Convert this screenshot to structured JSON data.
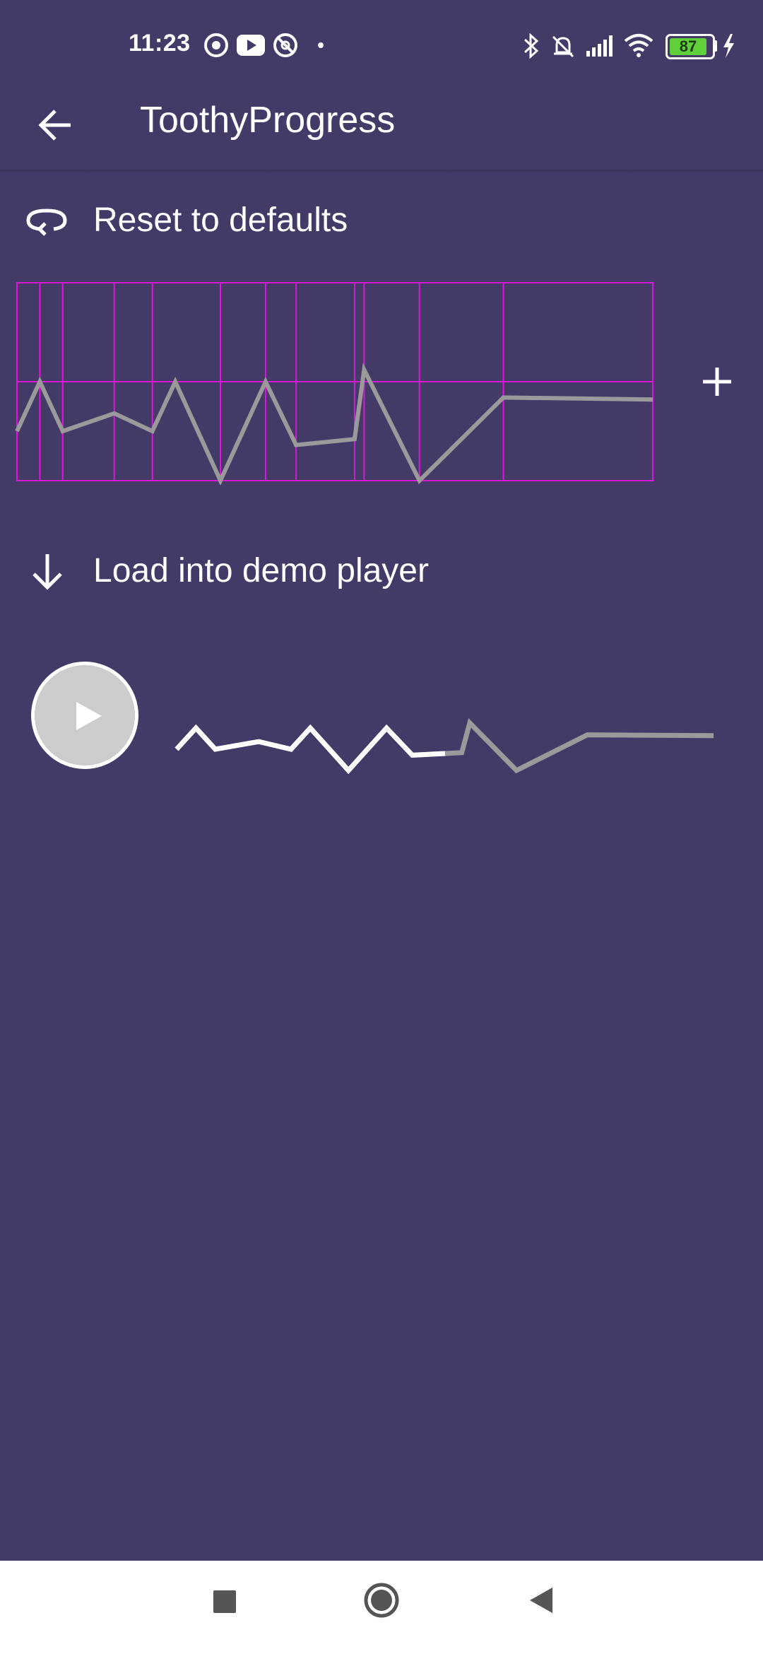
{
  "status_bar": {
    "time": "11:23",
    "battery": "87",
    "left_icons": [
      "screen-record-icon",
      "youtube-icon",
      "at-sign-icon",
      "dot-icon"
    ],
    "right_icons": [
      "bluetooth-icon",
      "silent-mode-icon",
      "signal-icon",
      "wifi-icon",
      "battery-icon",
      "charging-icon"
    ]
  },
  "app_bar": {
    "title": "ToothyProgress",
    "back_icon": "back-arrow-icon"
  },
  "actions": {
    "reset_label": "Reset to defaults",
    "load_label": "Load into demo player"
  },
  "editor": {
    "add_icon": "plus-icon",
    "grid_color": "#d61ad6",
    "line_color": "#9a9a9a",
    "segment_boundaries": [
      0,
      0.036,
      0.072,
      0.153,
      0.213,
      0.32,
      0.391,
      0.439,
      0.531,
      0.546,
      0.633,
      0.765,
      1
    ],
    "path_levels": [
      [
        0,
        0.25
      ],
      [
        0.036,
        0.5
      ],
      [
        0.072,
        0.25
      ],
      [
        0.153,
        0.34
      ],
      [
        0.213,
        0.25
      ],
      [
        0.249,
        0.5
      ],
      [
        0.32,
        0
      ],
      [
        0.391,
        0.5
      ],
      [
        0.439,
        0.18
      ],
      [
        0.531,
        0.21
      ],
      [
        0.546,
        0.56
      ],
      [
        0.633,
        0
      ],
      [
        0.765,
        0.42
      ],
      [
        1,
        0.41
      ]
    ]
  },
  "player": {
    "play_icon": "play-icon",
    "progress": 0.5,
    "played_color": "#ffffff",
    "remaining_color": "#9a9a9a"
  },
  "nav_bar": {
    "icons": [
      "recents-square-icon",
      "home-circle-icon",
      "back-triangle-icon"
    ]
  }
}
